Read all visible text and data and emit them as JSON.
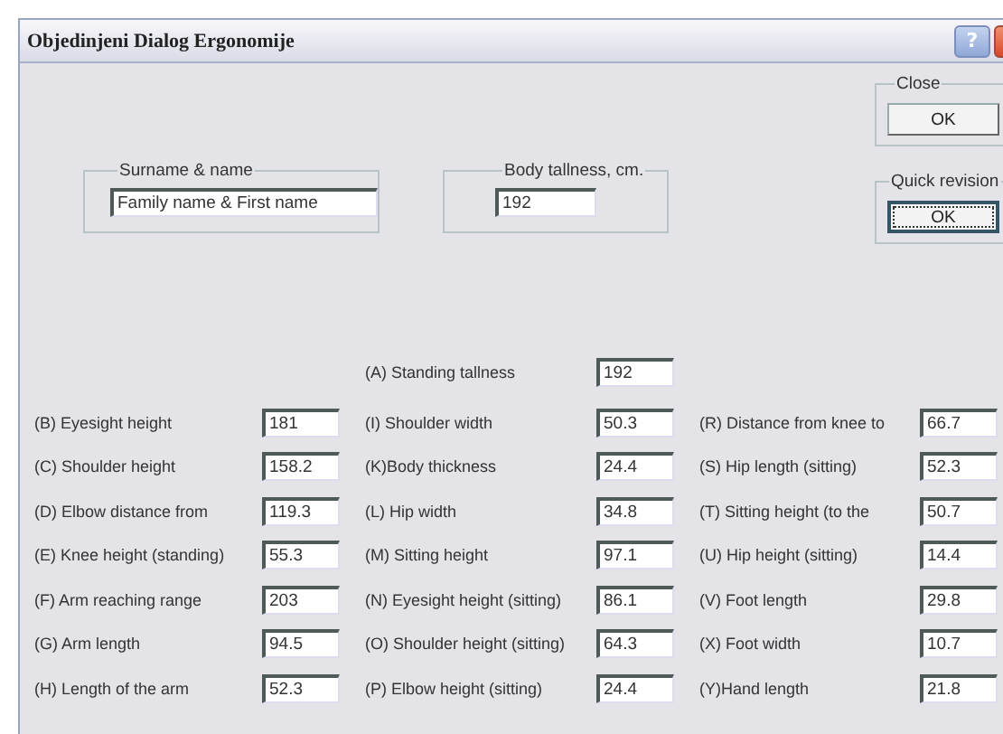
{
  "window": {
    "title": "Objedinjeni  Dialog  Ergonomije",
    "help": "?"
  },
  "name_group": {
    "label": "Surname & name",
    "value": "Family name & First name"
  },
  "tallness_group": {
    "label": "Body tallness, cm.",
    "value": "192"
  },
  "close_group": {
    "label": "Close",
    "button": {
      "label": "OK",
      "focused": false
    }
  },
  "quick_group": {
    "label": "Quick revision",
    "button": {
      "label": "OK",
      "focused": true
    }
  },
  "standing": {
    "label": "(A) Standing tallness",
    "value": "192"
  },
  "columns": [
    [
      {
        "label": "(B) Eyesight height",
        "value": "181"
      },
      {
        "label": "(C) Shoulder height",
        "value": "158.2"
      },
      {
        "label": "(D) Elbow distance from",
        "value": "119.3"
      },
      {
        "label": "(E) Knee height (standing)",
        "value": "55.3"
      },
      {
        "label": "(F) Arm reaching range",
        "value": "203"
      },
      {
        "label": "(G) Arm length",
        "value": "94.5"
      },
      {
        "label": "(H) Length of the arm",
        "value": "52.3"
      }
    ],
    [
      {
        "label": "(I) Shoulder width",
        "value": "50.3"
      },
      {
        "label": "(K)Body thickness",
        "value": "24.4"
      },
      {
        "label": "(L) Hip width",
        "value": "34.8"
      },
      {
        "label": "(M) Sitting height",
        "value": "97.1"
      },
      {
        "label": "(N) Eyesight height (sitting)",
        "value": "86.1"
      },
      {
        "label": "(O) Shoulder height (sitting)",
        "value": "64.3"
      },
      {
        "label": "(P) Elbow height (sitting)",
        "value": "24.4"
      }
    ],
    [
      {
        "label": "(R) Distance from knee to",
        "value": "66.7"
      },
      {
        "label": "(S) Hip length (sitting)",
        "value": "52.3"
      },
      {
        "label": "(T) Sitting height (to the",
        "value": "50.7"
      },
      {
        "label": "(U) Hip height (sitting)",
        "value": "14.4"
      },
      {
        "label": "(V) Foot length",
        "value": "29.8"
      },
      {
        "label": "(X) Foot width",
        "value": "10.7"
      },
      {
        "label": "(Y)Hand length",
        "value": "21.8"
      }
    ]
  ]
}
